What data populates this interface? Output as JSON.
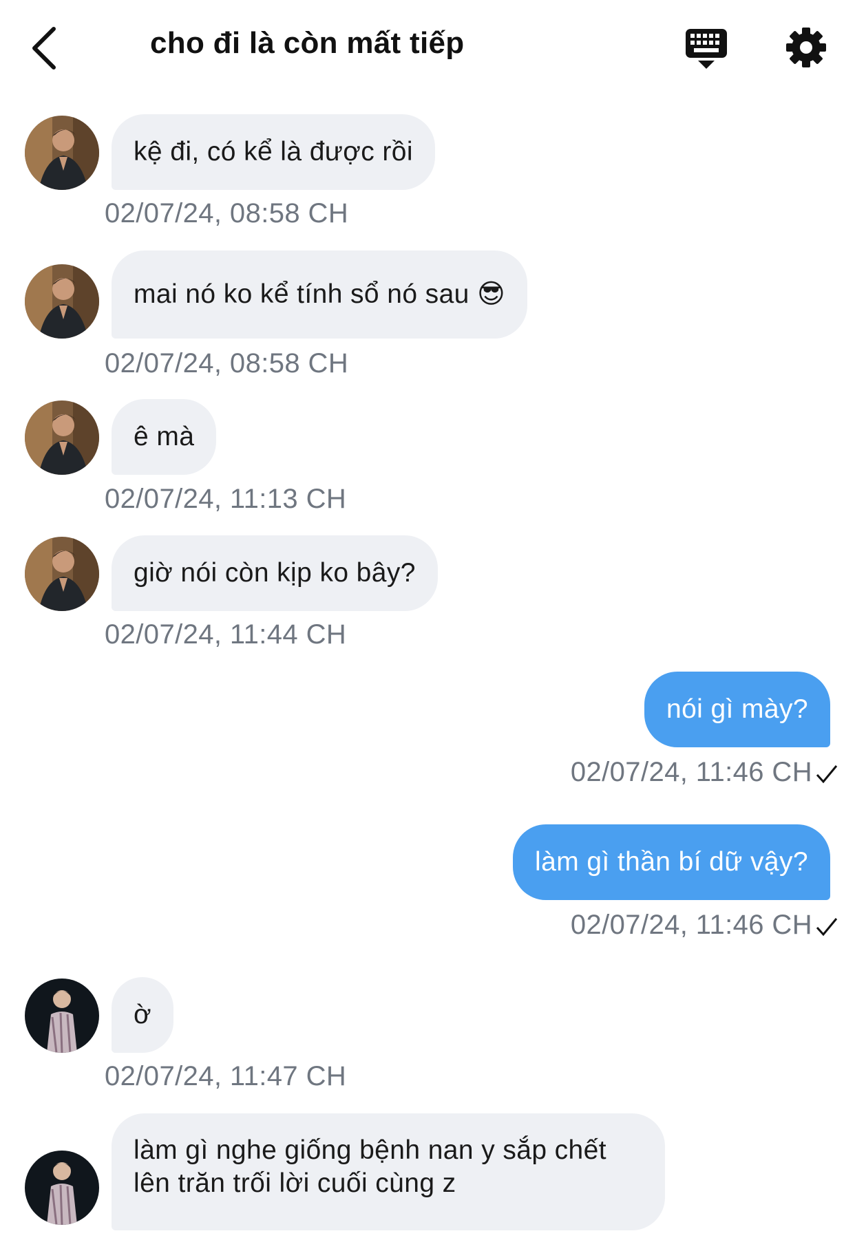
{
  "header": {
    "title": "cho đi là còn mất tiếp",
    "back_icon": "chevron-left-icon",
    "keyboard_icon": "keyboard-icon",
    "settings_icon": "gear-icon"
  },
  "messages": [
    {
      "direction": "in",
      "text": "kệ đi, có kể là được rồi",
      "time": "02/07/24, 08:58 CH"
    },
    {
      "direction": "in",
      "text": "mai nó ko kể tính sổ nó sau 😎",
      "time": "02/07/24, 08:58 CH"
    },
    {
      "direction": "in",
      "text": "ê mà",
      "time": "02/07/24, 11:13 CH"
    },
    {
      "direction": "in",
      "text": "giờ nói còn kịp ko bây?",
      "time": "02/07/24, 11:44 CH"
    },
    {
      "direction": "out",
      "text": "nói gì mày?",
      "time": "02/07/24, 11:46 CH",
      "status": "sent"
    },
    {
      "direction": "out",
      "text": "làm gì thần bí dữ vậy?",
      "time": "02/07/24, 11:46 CH",
      "status": "sent"
    },
    {
      "direction": "in",
      "text": "ờ",
      "time": "02/07/24, 11:47 CH"
    },
    {
      "direction": "in",
      "text": "làm gì nghe giống bệnh nan y sắp chết lên trăn trối lời cuối cùng z",
      "time": ""
    }
  ],
  "colors": {
    "incoming_bubble": "#eef0f4",
    "outgoing_bubble": "#4a9ff0",
    "timestamp": "#6f7680"
  }
}
